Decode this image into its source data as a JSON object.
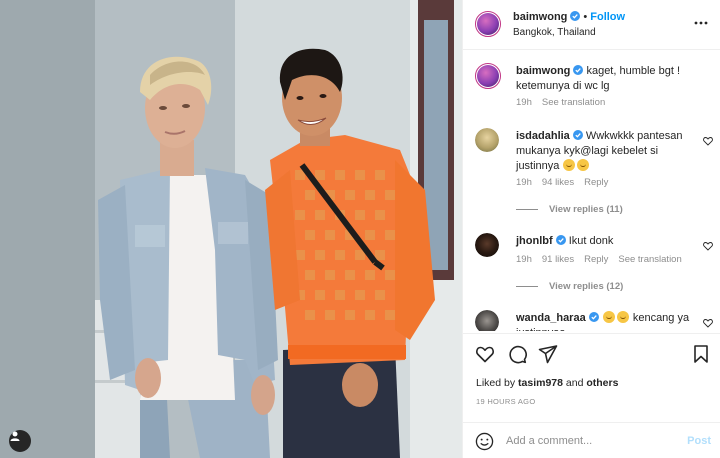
{
  "header": {
    "username": "baimwong",
    "follow_label": "Follow",
    "location": "Bangkok, Thailand"
  },
  "caption": {
    "username": "baimwong",
    "text": "kaget, humble bgt ! ketemunya di wc lg",
    "time": "19h",
    "translate": "See translation"
  },
  "comments": [
    {
      "username": "isdadahlia",
      "text": "Wwkwkkk pantesan mukanya kyk@lagi kebelet si justinnya",
      "time": "19h",
      "likes": "94 likes",
      "reply": "Reply",
      "view_replies": "View replies (11)"
    },
    {
      "username": "jhonlbf",
      "text": "Ikut donk",
      "time": "19h",
      "likes": "91 likes",
      "reply": "Reply",
      "translate": "See translation",
      "view_replies": "View replies (12)"
    },
    {
      "username": "wanda_haraa",
      "text": "kencang ya",
      "text_cut": "justinnyaa"
    }
  ],
  "likes": {
    "prefix": "Liked by ",
    "user": "tasim978",
    "and": " and ",
    "others": "others"
  },
  "time_ago": "19 HOURS AGO",
  "add_comment": {
    "placeholder": "Add a comment...",
    "post_label": "Post"
  },
  "colors": {
    "accent": "#0095f6",
    "verified": "#3897f0",
    "sweater": "#f47a3a",
    "muted": "#8e8e8e"
  },
  "icons": [
    "verified-badge-icon",
    "more-options-icon",
    "heart-icon",
    "comment-icon",
    "share-icon",
    "bookmark-icon",
    "emoji-icon",
    "user-tag-icon"
  ]
}
